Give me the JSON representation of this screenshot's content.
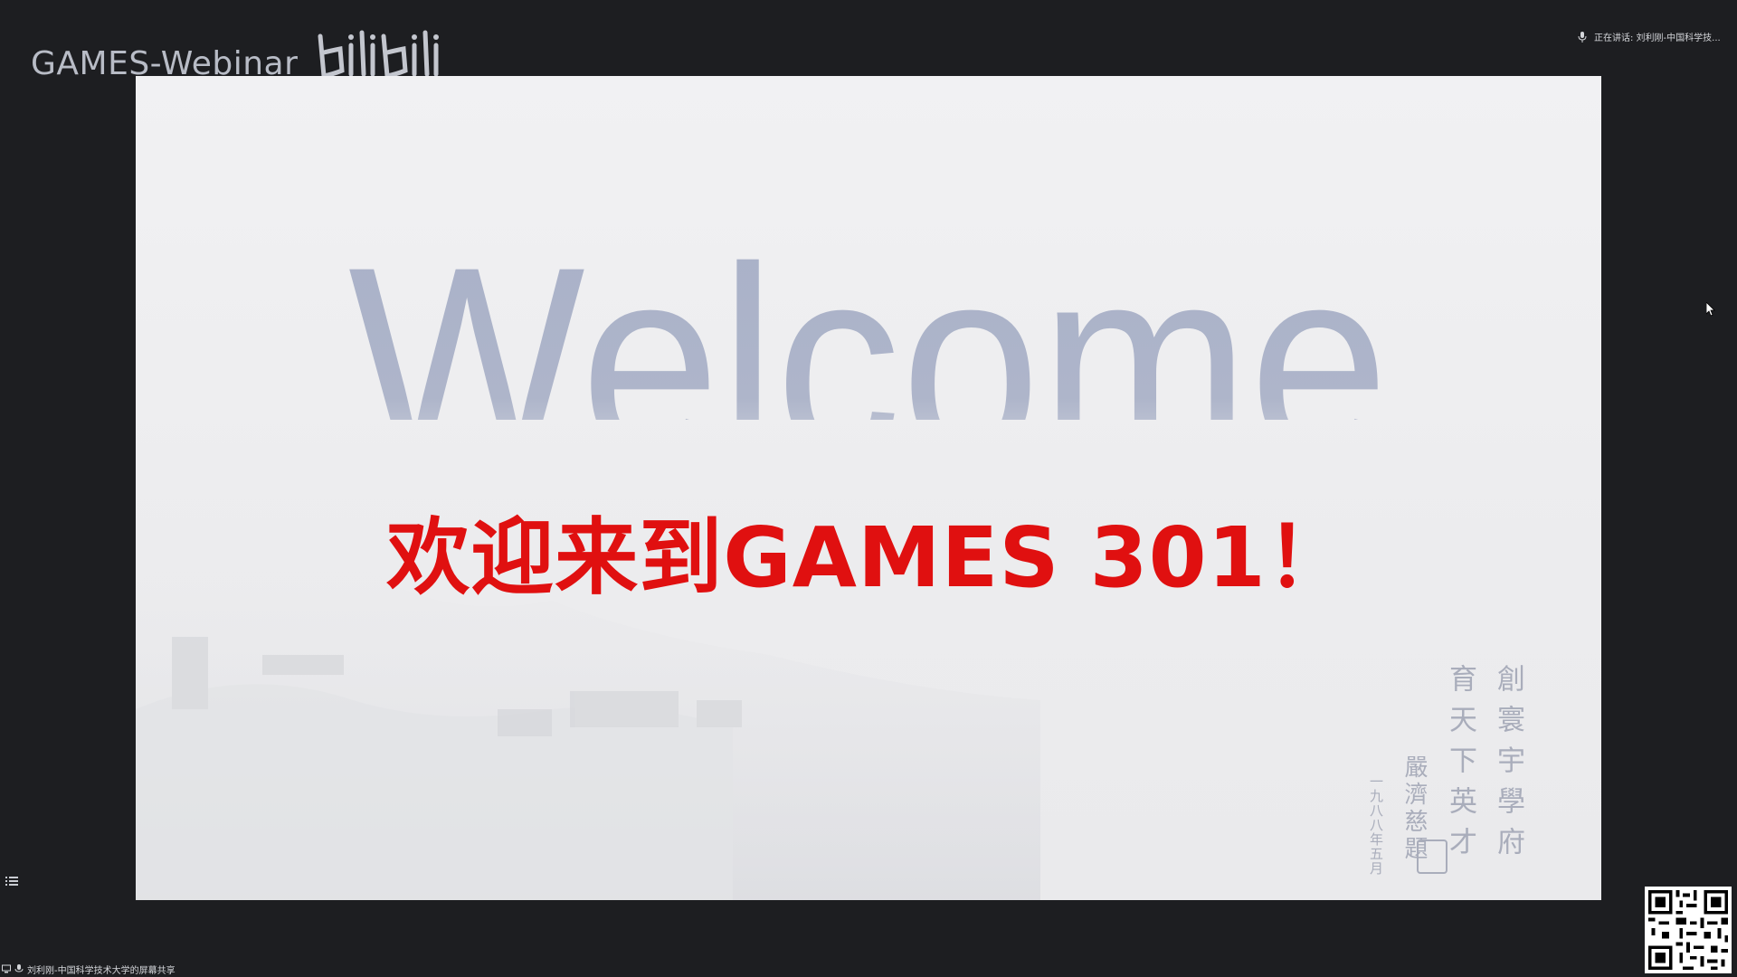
{
  "header": {
    "brand_title": "GAMES-Webinar",
    "logo_name": "bilibili"
  },
  "speaking": {
    "text": "正在讲话: 刘利刚-中国科学技..."
  },
  "slide": {
    "welcome_text": "Welcome",
    "headline": "欢迎来到GAMES 301！",
    "calligraphy_columns": [
      "創寰宇學府",
      "育天下英才"
    ],
    "calligraphy_signature": "嚴濟慈題",
    "calligraphy_date": "一九八八年五月"
  },
  "status": {
    "share_text": "刘利刚-中国科学技术大学的屏幕共享"
  },
  "colors": {
    "background": "#1d1e21",
    "headline_red": "#e01010",
    "welcome_gray_blue": "#a7afc7",
    "calligraphy_gray": "#a9adbb"
  },
  "icons": [
    "mic-icon",
    "cursor-icon",
    "list-icon",
    "screen-share-icon",
    "qr-code-icon",
    "bilibili-logo-icon"
  ]
}
